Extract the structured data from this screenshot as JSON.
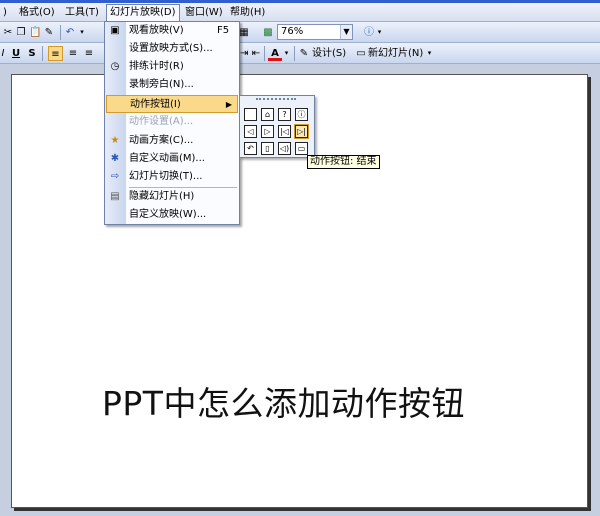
{
  "menubar": {
    "items": [
      {
        "label": ")"
      },
      {
        "label": "格式(O)"
      },
      {
        "label": "工具(T)"
      },
      {
        "label": "幻灯片放映(D)"
      },
      {
        "label": "窗口(W)"
      },
      {
        "label": "帮助(H)"
      }
    ]
  },
  "toolbar": {
    "zoom_value": "76%",
    "underline_label": "U",
    "shadow_label": "S",
    "font_color_label": "A",
    "design_label": "设计(S)",
    "new_slide_label": "新幻灯片(N)"
  },
  "slideshow_menu": {
    "items": [
      {
        "label": "观看放映(V)",
        "shortcut": "F5",
        "icon": "projector-icon"
      },
      {
        "label": "设置放映方式(S)...",
        "shortcut": "",
        "icon": ""
      },
      {
        "label": "排练计时(R)",
        "shortcut": "",
        "icon": "clock-icon"
      },
      {
        "label": "录制旁白(N)...",
        "shortcut": "",
        "icon": ""
      },
      {
        "label": "动作按钮(I)",
        "shortcut": "",
        "icon": "",
        "highlighted": true
      },
      {
        "label": "动作设置(A)...",
        "shortcut": "",
        "icon": "",
        "disabled": true
      },
      {
        "label": "动画方案(C)...",
        "shortcut": "",
        "icon": "star-icon"
      },
      {
        "label": "自定义动画(M)...",
        "shortcut": "",
        "icon": "animation-icon"
      },
      {
        "label": "幻灯片切换(T)...",
        "shortcut": "",
        "icon": "transition-icon"
      },
      {
        "label": "隐藏幻灯片(H)",
        "shortcut": "",
        "icon": "hide-slide-icon"
      },
      {
        "label": "自定义放映(W)...",
        "shortcut": "",
        "icon": ""
      }
    ]
  },
  "action_buttons": {
    "tooltip": "动作按钮: 结束",
    "buttons": [
      "custom-button",
      "home-button",
      "help-button",
      "information-button",
      "back-button",
      "forward-button",
      "beginning-button",
      "end-button",
      "return-button",
      "document-button",
      "sound-button",
      "movie-button"
    ]
  },
  "slide": {
    "title": "PPT中怎么添加动作按钮"
  }
}
